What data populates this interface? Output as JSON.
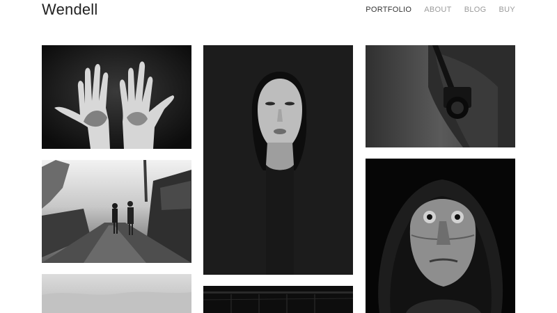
{
  "site": {
    "brand": "Wendell"
  },
  "nav": {
    "items": [
      {
        "label": "PORTFOLIO",
        "active": true
      },
      {
        "label": "ABOUT",
        "active": false
      },
      {
        "label": "BLOG",
        "active": false
      },
      {
        "label": "BUY",
        "active": false
      }
    ]
  },
  "gallery": {
    "style": "black-and-white photography grid",
    "columns": 3,
    "photos": [
      {
        "subject": "two raised dirty hands"
      },
      {
        "subject": "people walking down a destroyed street"
      },
      {
        "subject": "overcast sky landscape"
      },
      {
        "subject": "portrait of a young woman"
      },
      {
        "subject": "dark interior"
      },
      {
        "subject": "person with camera strap over shoulder"
      },
      {
        "subject": "elderly man in a hood"
      }
    ]
  }
}
